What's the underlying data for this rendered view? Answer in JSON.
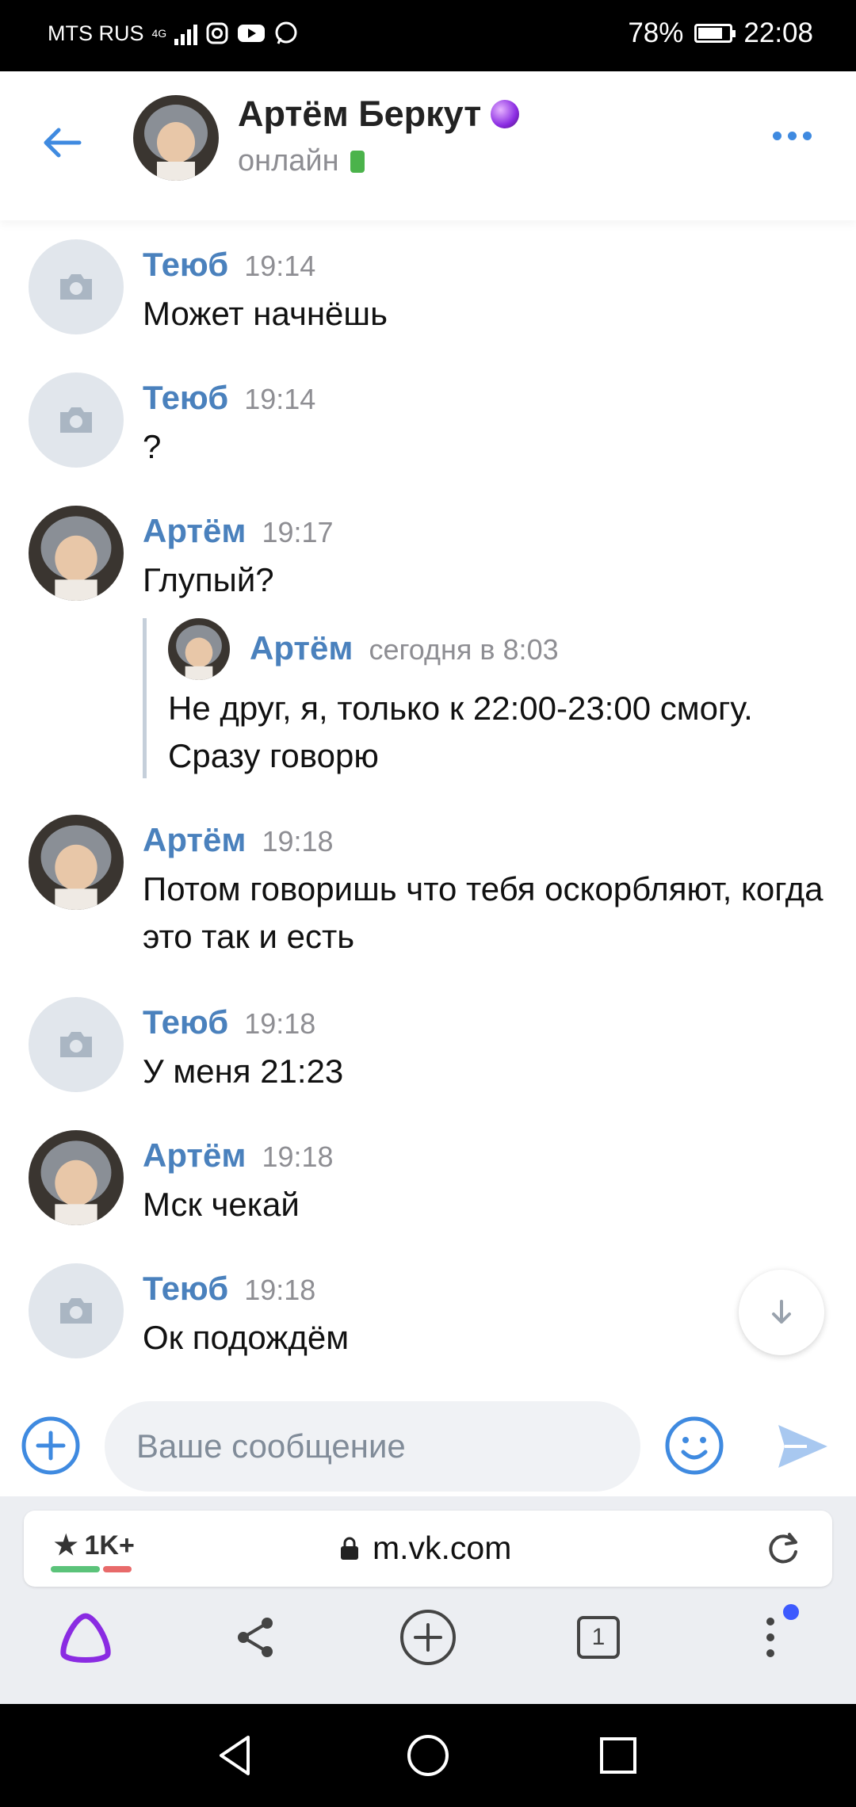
{
  "status_bar": {
    "carrier": "MTS RUS",
    "network": "4G",
    "battery": "78%",
    "battery_level": 0.78,
    "time": "22:08"
  },
  "header": {
    "name": "Артём Беркут",
    "status": "онлайн"
  },
  "messages": [
    {
      "author": "Теюб",
      "time": "19:14",
      "text": "Может начнёшь",
      "avatar": "camera-placeholder"
    },
    {
      "author": "Теюб",
      "time": "19:14",
      "text": "?",
      "avatar": "camera-placeholder"
    },
    {
      "author": "Артём",
      "time": "19:17",
      "text": "Глупый?",
      "avatar": "photo",
      "reply": {
        "author": "Артём",
        "time": "сегодня в 8:03",
        "text": "Не друг, я, только к 22:00-23:00 смогу. Сразу говорю"
      }
    },
    {
      "author": "Артём",
      "time": "19:18",
      "text": "Потом говоришь что тебя оскорбляют, когда это так и есть",
      "avatar": "photo"
    },
    {
      "author": "Теюб",
      "time": "19:18",
      "text": "У меня 21:23",
      "avatar": "camera-placeholder"
    },
    {
      "author": "Артём",
      "time": "19:18",
      "text": "Мск чекай",
      "avatar": "photo"
    },
    {
      "author": "Теюб",
      "time": "19:18",
      "text": "Ок подождём",
      "avatar": "camera-placeholder"
    }
  ],
  "composer": {
    "placeholder": "Ваше сообщение"
  },
  "browser": {
    "rating": "1K+",
    "url": "m.vk.com",
    "tab_count": "1"
  },
  "colors": {
    "accent": "#3f8ae0",
    "author": "#4a81bd",
    "online": "#4bb34b",
    "alice": "#8a2be2"
  }
}
